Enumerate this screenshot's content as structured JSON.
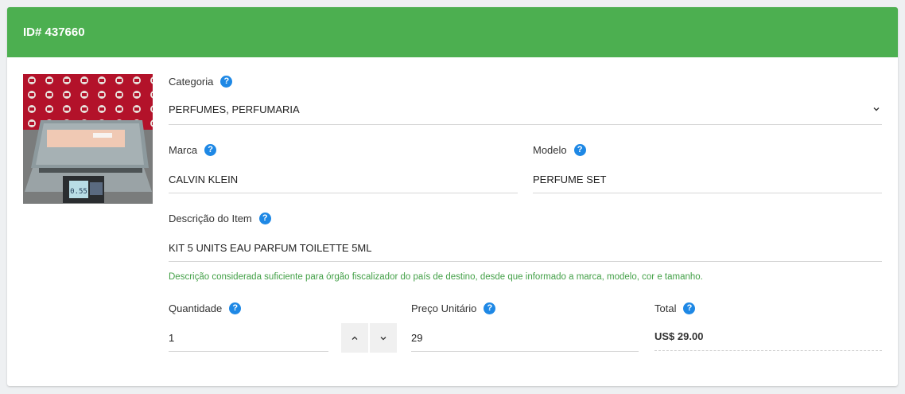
{
  "header": {
    "title": "ID# 437660"
  },
  "product_image": {
    "alt": "Produto na balança",
    "scale_display": "0.55"
  },
  "categoria": {
    "label": "Categoria",
    "value": "PERFUMES, PERFUMARIA"
  },
  "marca": {
    "label": "Marca",
    "value": "CALVIN KLEIN"
  },
  "modelo": {
    "label": "Modelo",
    "value": "PERFUME SET"
  },
  "descricao": {
    "label": "Descrição do Item",
    "value": "KIT 5 UNITS EAU PARFUM TOILETTE 5ML",
    "hint": "Descrição considerada suficiente para órgão fiscalizador do país de destino, desde que informado a marca, modelo, cor e tamanho."
  },
  "quantidade": {
    "label": "Quantidade",
    "value": "1"
  },
  "preco": {
    "label": "Preço Unitário",
    "value": "29"
  },
  "total": {
    "label": "Total",
    "value": "US$ 29.00"
  },
  "help_glyph": "?",
  "colors": {
    "header": "#4caf50",
    "help": "#1e88e5",
    "hint": "#43a047"
  },
  "icons": [
    "question-icon",
    "chevron-down-icon",
    "chevron-up-icon"
  ]
}
